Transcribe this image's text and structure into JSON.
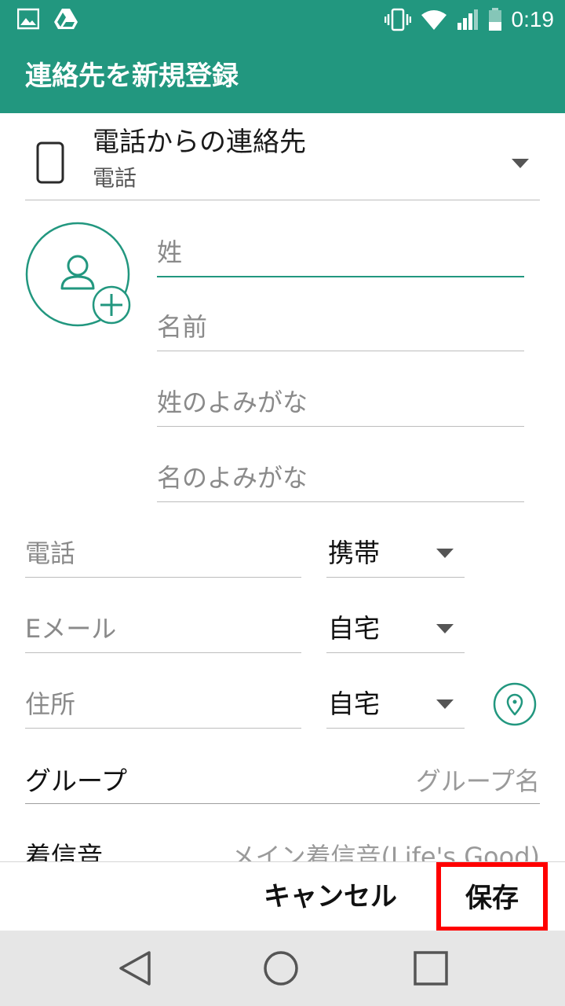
{
  "status_bar": {
    "time": "0:19",
    "left_icons": [
      "image-icon",
      "drive-icon"
    ],
    "right_icons": [
      "vibrate-icon",
      "wifi-icon",
      "signal-icon",
      "battery-icon"
    ]
  },
  "app_bar": {
    "title": "連絡先を新規登録"
  },
  "account": {
    "name": "電話からの連絡先",
    "type": "電話"
  },
  "name_fields": {
    "last_name": "姓",
    "first_name": "名前",
    "last_name_kana": "姓のよみがな",
    "first_name_kana": "名のよみがな"
  },
  "contact_fields": {
    "phone": {
      "placeholder": "電話",
      "type": "携帯"
    },
    "email": {
      "placeholder": "Eメール",
      "type": "自宅"
    },
    "address": {
      "placeholder": "住所",
      "type": "自宅"
    }
  },
  "group": {
    "label": "グループ",
    "value": "グループ名"
  },
  "ringtone": {
    "label": "着信音",
    "value": "メイン着信音(Life's Good)"
  },
  "actions": {
    "cancel": "キャンセル",
    "save": "保存"
  },
  "colors": {
    "accent": "#22977f",
    "highlight": "#ff0000"
  }
}
